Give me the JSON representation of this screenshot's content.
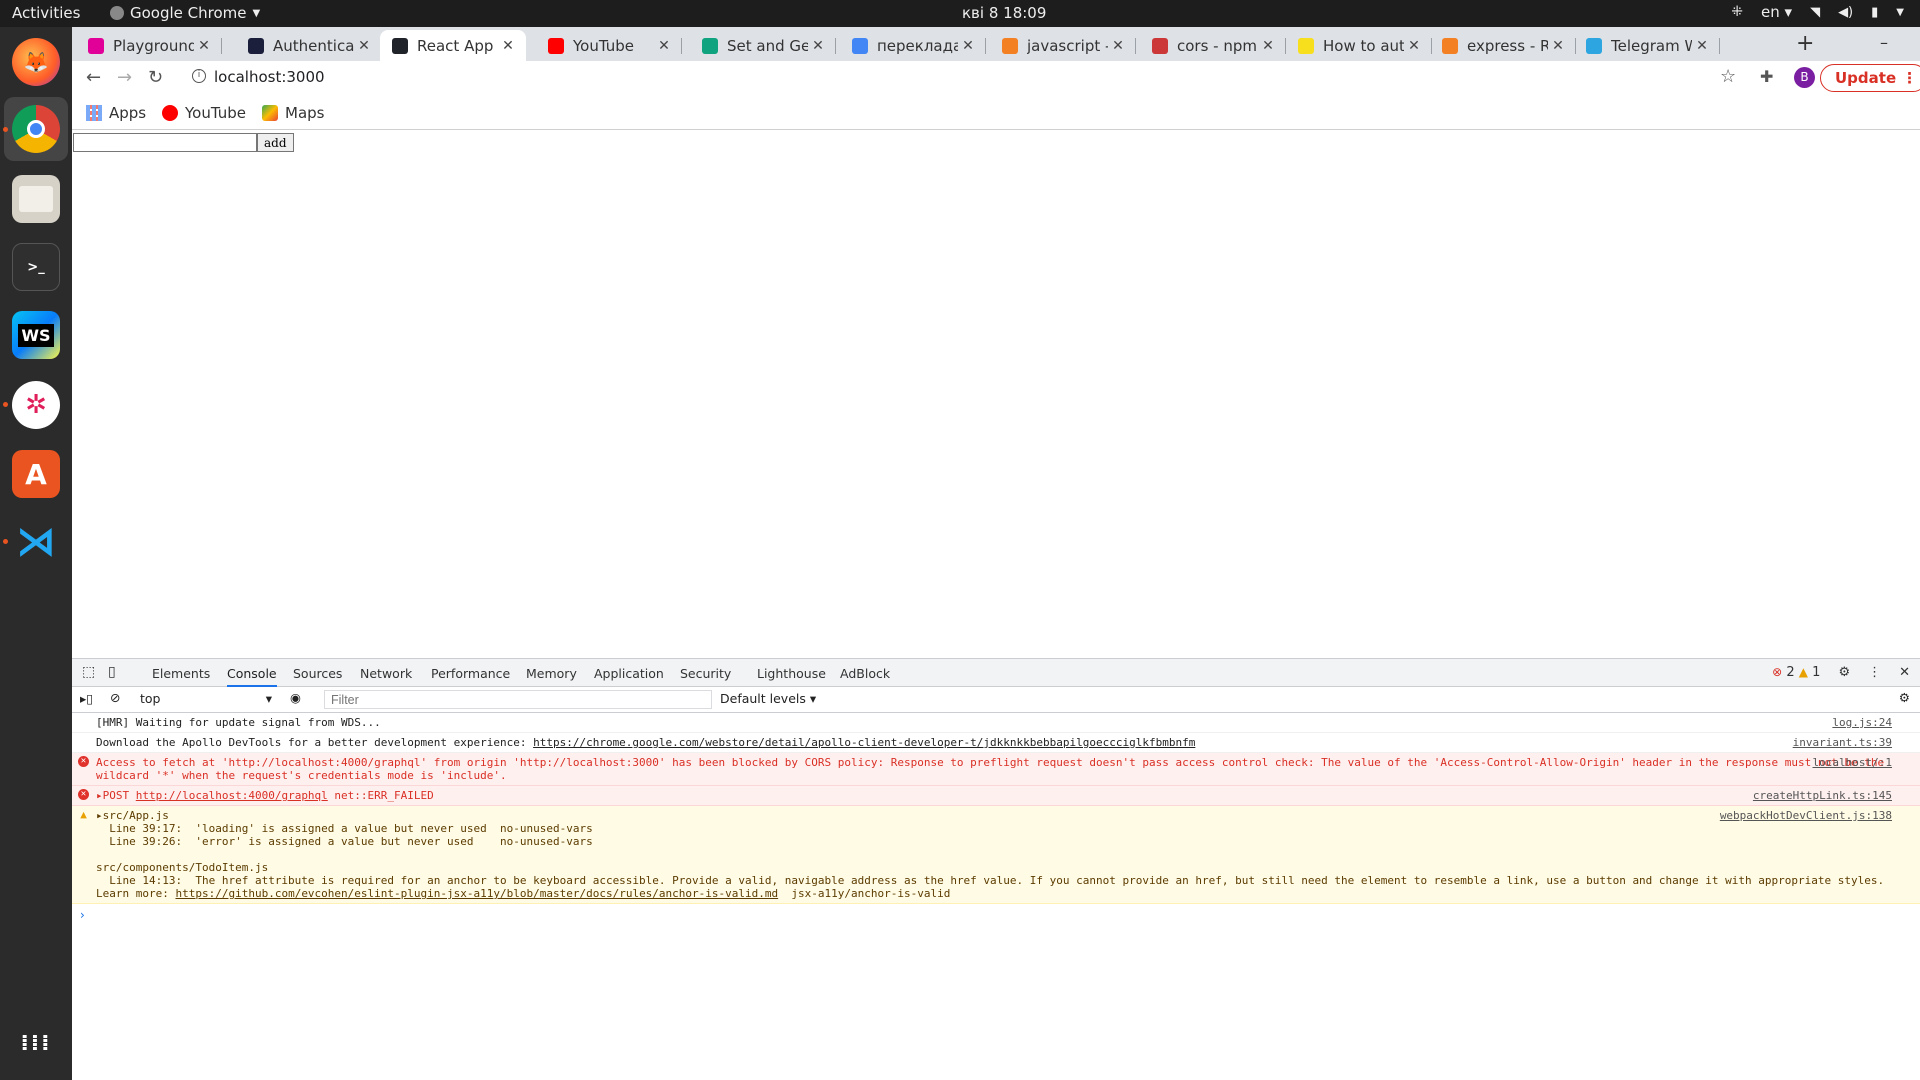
{
  "topbar": {
    "activities": "Activities",
    "app_name": "Google Chrome",
    "clock": "кві 8  18:09",
    "lang": "en"
  },
  "dock": {
    "items": [
      "firefox",
      "chrome",
      "files",
      "terminal",
      "webstorm",
      "slack",
      "software",
      "vscode"
    ]
  },
  "tabs": [
    {
      "title": "Playground",
      "color": "#e10098"
    },
    {
      "title": "Authenticat",
      "color": "#1b1f3b"
    },
    {
      "title": "React App",
      "color": "#20232a"
    },
    {
      "title": "YouTube",
      "color": "#ff0000"
    },
    {
      "title": "Set and Get c",
      "color": "#10a37f"
    },
    {
      "title": "перекладач",
      "color": "#4285f4"
    },
    {
      "title": "javascript - N",
      "color": "#f48024"
    },
    {
      "title": "cors - npm",
      "color": "#cb3837"
    },
    {
      "title": "How to auth",
      "color": "#f7df1e"
    },
    {
      "title": "express - Re",
      "color": "#f48024"
    },
    {
      "title": "Telegram W",
      "color": "#2ca5e0"
    }
  ],
  "toolbar": {
    "url": "localhost:3000",
    "avatar_letter": "B",
    "update_label": "Update"
  },
  "bookmarks": {
    "apps": "Apps",
    "youtube": "YouTube",
    "maps": "Maps"
  },
  "page": {
    "add_label": "add",
    "input_value": ""
  },
  "devtools": {
    "tabs": [
      "Elements",
      "Console",
      "Sources",
      "Network",
      "Performance",
      "Memory",
      "Application",
      "Security",
      "Lighthouse",
      "AdBlock"
    ],
    "active_tab": "Console",
    "error_count": "2",
    "warning_count": "1",
    "context": "top",
    "filter_placeholder": "Filter",
    "levels": "Default levels"
  },
  "console": {
    "messages": [
      {
        "type": "log",
        "text": "[HMR] Waiting for update signal from WDS...",
        "src": "log.js:24"
      },
      {
        "type": "log",
        "text_prefix": "Download the Apollo DevTools for a better development experience: ",
        "link": "https://chrome.google.com/webstore/detail/apollo-client-developer-t/jdkknkkbebbapilgoeccciglkfbmbnfm",
        "src": "invariant.ts:39"
      },
      {
        "type": "error",
        "text": "Access to fetch at 'http://localhost:4000/graphql' from origin 'http://localhost:3000' has been blocked by CORS policy: Response to preflight request doesn't pass access control check: The value of the 'Access-Control-Allow-Origin' header in the response must not be the wildcard '*' when the request's credentials mode is 'include'.",
        "src": "localhost/:1"
      },
      {
        "type": "error",
        "text_prefix": "▸POST ",
        "link": "http://localhost:4000/graphql",
        "text_suffix": " net::ERR_FAILED",
        "src": "createHttpLink.ts:145"
      },
      {
        "type": "warning",
        "text": "▸src/App.js\n  Line 39:17:  'loading' is assigned a value but never used  no-unused-vars\n  Line 39:26:  'error' is assigned a value but never used    no-unused-vars\n\nsrc/components/TodoItem.js\n  Line 14:13:  The href attribute is required for an anchor to be keyboard accessible. Provide a valid, navigable address as the href value. If you cannot provide an href, but still need the element to resemble a link, use a button and change it with appropriate styles.\nLearn more: ",
        "link": "https://github.com/evcohen/eslint-plugin-jsx-a11y/blob/master/docs/rules/anchor-is-valid.md",
        "text_suffix": "  jsx-a11y/anchor-is-valid",
        "src": "webpackHotDevClient.js:138"
      }
    ]
  }
}
